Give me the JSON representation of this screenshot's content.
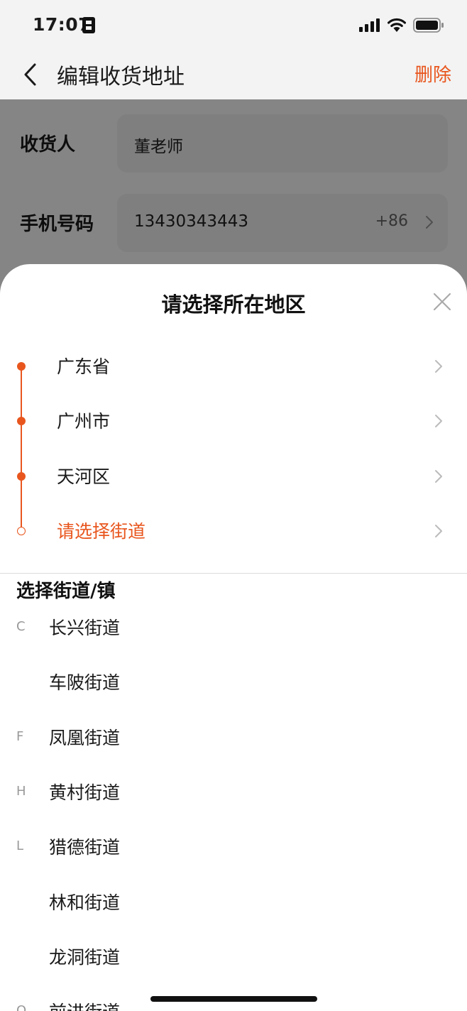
{
  "status_bar": {
    "time": "17:07"
  },
  "nav": {
    "title": "编辑收货地址",
    "delete_label": "删除"
  },
  "form": {
    "recipient": {
      "label": "收货人",
      "value": "董老师"
    },
    "phone": {
      "label": "手机号码",
      "value": "13430343443",
      "country_code": "+86"
    }
  },
  "sheet": {
    "title": "请选择所在地区",
    "steps": [
      {
        "label": "广东省",
        "state": "selected"
      },
      {
        "label": "广州市",
        "state": "selected"
      },
      {
        "label": "天河区",
        "state": "selected"
      },
      {
        "label": "请选择街道",
        "state": "pending"
      }
    ],
    "section_title": "选择街道/镇",
    "streets": [
      {
        "letter": "C",
        "name": "长兴街道"
      },
      {
        "letter": "",
        "name": "车陂街道"
      },
      {
        "letter": "F",
        "name": "凤凰街道"
      },
      {
        "letter": "H",
        "name": "黄村街道"
      },
      {
        "letter": "L",
        "name": "猎德街道"
      },
      {
        "letter": "",
        "name": "林和街道"
      },
      {
        "letter": "",
        "name": "龙洞街道"
      },
      {
        "letter": "Q",
        "name": "前进街道"
      }
    ]
  },
  "colors": {
    "accent": "#e8561e",
    "overlay": "#000000",
    "field_background": "#f4f4f4"
  },
  "icons": {
    "back": "chevron-left-icon",
    "close": "close-icon",
    "row_chevron": "chevron-right-icon",
    "status": [
      "sim-card-icon",
      "cellular-signal-icon",
      "wifi-icon",
      "battery-icon"
    ]
  }
}
